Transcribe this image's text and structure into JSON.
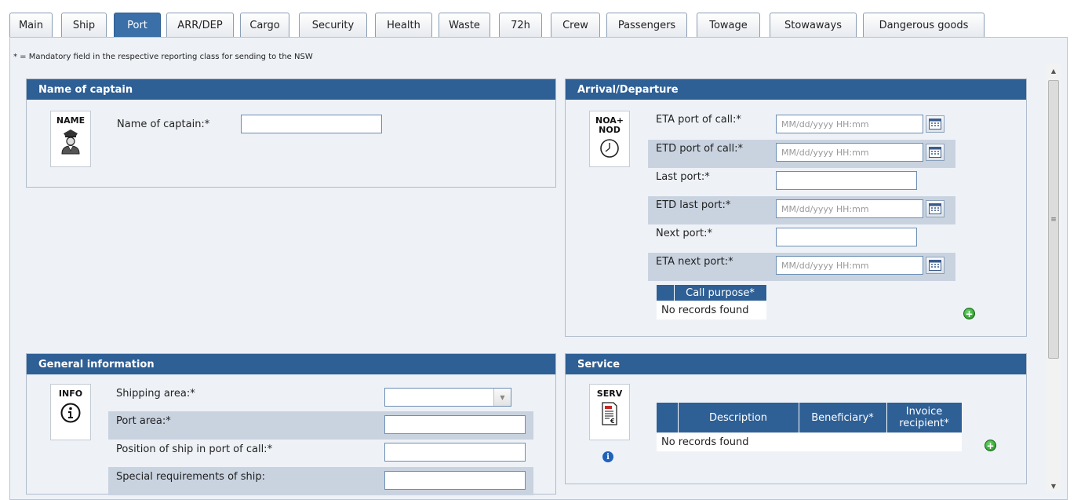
{
  "tabs": [
    "Main",
    "Ship",
    "Port",
    "ARR/DEP",
    "Cargo",
    "Security",
    "Health",
    "Waste",
    "72h",
    "Crew",
    "Passengers",
    "Towage",
    "Stowaways",
    "Dangerous goods"
  ],
  "active_tab": "Port",
  "note": "* = Mandatory field in the respective reporting class for sending to the NSW",
  "captain": {
    "title": "Name of captain",
    "badge": "NAME",
    "label": "Name of captain:*",
    "value": ""
  },
  "arrival": {
    "title": "Arrival/Departure",
    "badge_line1": "NOA+",
    "badge_line2": "NOD",
    "eta_port_label": "ETA port of call:*",
    "etd_port_label": "ETD port of call:*",
    "last_port_label": "Last port:*",
    "etd_last_label": "ETD last port:*",
    "next_port_label": "Next port:*",
    "eta_next_label": "ETA next port:*",
    "date_placeholder": "MM/dd/yyyy HH:mm",
    "call_purpose_header": "Call purpose*",
    "no_records": "No records found"
  },
  "general": {
    "title": "General information",
    "badge": "INFO",
    "shipping_area_label": "Shipping area:*",
    "port_area_label": "Port area:*",
    "position_label": "Position of ship in port of call:*",
    "special_label": "Special requirements of ship:"
  },
  "service": {
    "title": "Service",
    "badge": "SERV",
    "col_description": "Description",
    "col_beneficiary": "Beneficiary*",
    "col_invoice_line1": "Invoice",
    "col_invoice_line2": "recipient*",
    "no_records": "No records found"
  },
  "colors": {
    "header_blue": "#2e5f95",
    "active_tab": "#3a6fa8",
    "panel_bg": "#eef2f7",
    "shade_row": "#c9d3e0"
  }
}
